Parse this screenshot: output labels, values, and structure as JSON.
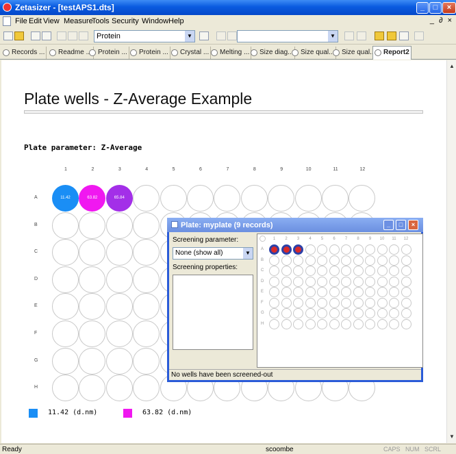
{
  "window": {
    "title": "Zetasizer - [testAPS1.dts]"
  },
  "menu": [
    "File",
    "Edit",
    "View",
    "Measure",
    "Tools",
    "Security",
    "Window",
    "Help"
  ],
  "toolbar": {
    "combo_value": "Protein"
  },
  "tabs": [
    "Records ...",
    "Readme ...",
    "Protein ...",
    "Protein ...",
    "Crystal ...",
    "Melting ...",
    "Size diag...",
    "Size qual...",
    "Size qual...",
    "Report2"
  ],
  "report": {
    "title": "Plate wells - Z-Average Example",
    "parameter_label": "Plate parameter: Z-Average",
    "columns": [
      "1",
      "2",
      "3",
      "4",
      "5",
      "6",
      "7",
      "8",
      "9",
      "10",
      "11",
      "12"
    ],
    "rows": [
      "A",
      "B",
      "C",
      "D",
      "E",
      "F",
      "G",
      "H"
    ],
    "filled_wells": [
      {
        "row": "A",
        "col": "1",
        "value": "11.42",
        "color": "#1a8ef5"
      },
      {
        "row": "A",
        "col": "2",
        "value": "63.82",
        "color": "#f018f0"
      },
      {
        "row": "A",
        "col": "3",
        "value": "65.84",
        "color": "#a32fe8"
      }
    ],
    "legend": [
      {
        "label": "11.42 (d.nm)",
        "color": "#1a8ef5"
      },
      {
        "label": "63.82 (d.nm)",
        "color": "#f018f0"
      }
    ]
  },
  "dialog": {
    "title": "Plate: myplate  (9 records)",
    "screening_parameter_label": "Screening parameter:",
    "screening_parameter_value": "None (show all)",
    "screening_properties_label": "Screening properties:",
    "status": "No wells have been screened-out",
    "mini_columns": [
      "1",
      "2",
      "3",
      "4",
      "5",
      "6",
      "7",
      "8",
      "9",
      "10",
      "11",
      "12"
    ],
    "mini_rows": [
      "A",
      "B",
      "C",
      "D",
      "E",
      "F",
      "G",
      "H"
    ],
    "selected_wells": [
      "1",
      "2",
      "3"
    ]
  },
  "status": {
    "left": "Ready",
    "user": "scoombe",
    "indicators": [
      "CAPS",
      "NUM",
      "SCRL"
    ]
  }
}
